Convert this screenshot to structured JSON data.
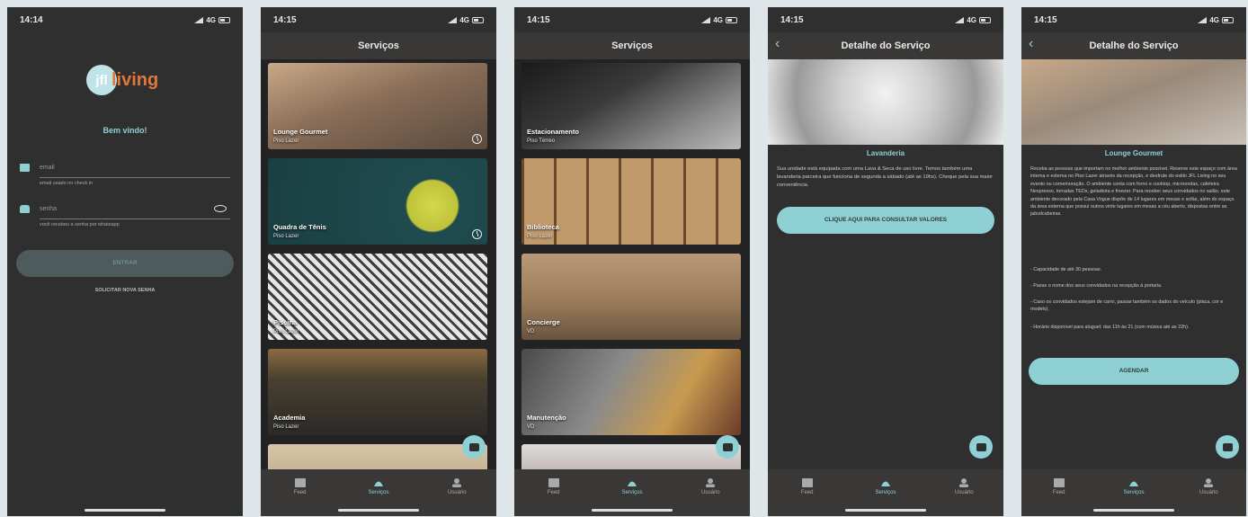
{
  "screens": {
    "login": {
      "time": "14:14",
      "network": "4G",
      "logo_mark": "jfl",
      "logo_word": "living",
      "welcome": "Bem vindo!",
      "email_placeholder": "email",
      "email_hint": "email usado no check in",
      "password_placeholder": "senha",
      "password_hint": "você recebeu a senha por whatsapp",
      "login_button": "ENTRAR",
      "new_password_link": "SOLICITAR NOVA SENHA"
    },
    "services1": {
      "time": "14:15",
      "network": "4G",
      "title": "Serviços",
      "cards": [
        {
          "title": "Lounge Gourmet",
          "sub": "Piso Lazer"
        },
        {
          "title": "Quadra de Tênis",
          "sub": "Piso Lazer"
        },
        {
          "title": "Piscina",
          "sub": "Piso Lazer"
        },
        {
          "title": "Academia",
          "sub": "Piso Lazer"
        }
      ]
    },
    "services2": {
      "time": "14:15",
      "network": "4G",
      "title": "Serviços",
      "cards": [
        {
          "title": "Estacionamento",
          "sub": "Piso Térreo"
        },
        {
          "title": "Biblioteca",
          "sub": "Piso Lazer"
        },
        {
          "title": "Concierge",
          "sub": "VD"
        },
        {
          "title": "Manutenção",
          "sub": "VD"
        }
      ]
    },
    "detail1": {
      "time": "14:15",
      "network": "4G",
      "title": "Detalhe do Serviço",
      "service_name": "Lavanderia",
      "description": "Sua unidade está equipada com uma Lava & Seca de uso livre. Temos também uma lavanderia parceira que funciona de segunda a sábado (até as 19hs). Cheque pela sua maior conveniência.",
      "button": "CLIQUE AQUI PARA CONSULTAR VALORES"
    },
    "detail2": {
      "time": "14:15",
      "network": "4G",
      "title": "Detalhe do Serviço",
      "service_name": "Lounge Gourmet",
      "description": "Receba as pessoas que importam no melhor ambiente possível. Reserve este espaço com área interna e externa no Piso Lazer através da recepção, e desfrute do estilo JFL Living no seu evento ou comemoração. O ambiente conta com forno e cooktop, microondas, cafeteira Nespresso, torradas TEDs, geladeira e freezer. Para receber seus convidados no salão, este ambiente decorado pela Casa Vogue dispõe de 14 lugares em mesas e sofás, além do espaço da área externa que possui outros vinte lugares em mesas a céu aberto, dispostas entre as jabuticabeiras.",
      "bullets": [
        "- Capacidade de até 30 pessoas.",
        "- Passe o nome dos seus convidados na recepção à portaria.",
        "- Caso os convidados estejam de carro, passar também os dados do veículo (placa, cor e modelo).",
        "- Horário disponível para aluguel: das 11h às 21 (com música até as 22h)."
      ],
      "button": "AGENDAR"
    }
  },
  "tabs": {
    "feed": "Feed",
    "services": "Serviços",
    "profile": "Usuário"
  },
  "colors": {
    "accent": "#8fd0d5",
    "brand_orange": "#e0783a",
    "background": "#2f2f2f"
  }
}
